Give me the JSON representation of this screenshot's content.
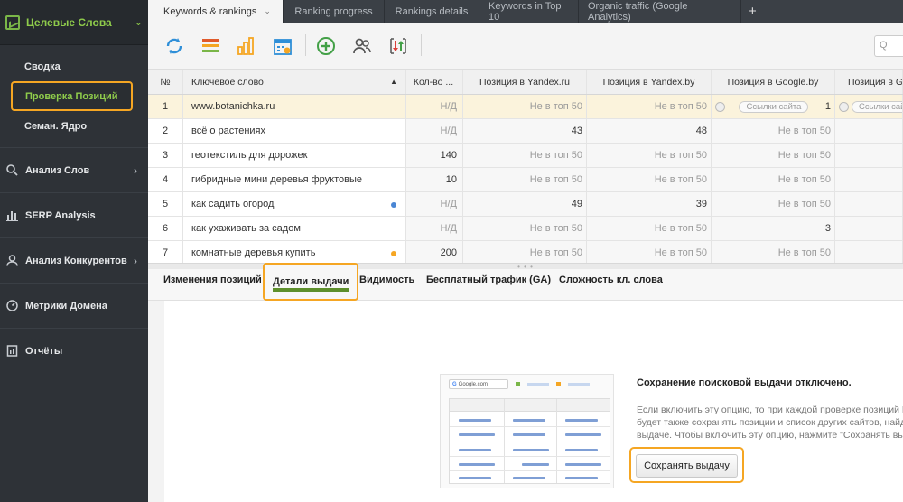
{
  "sidebar": {
    "top": {
      "label": "Целевые Слова"
    },
    "subitems": [
      {
        "label": "Сводка"
      },
      {
        "label": "Проверка Позиций"
      },
      {
        "label": "Семан. Ядро"
      }
    ],
    "items": [
      {
        "label": "Анализ Слов",
        "icon": "search-icon"
      },
      {
        "label": "SERP Analysis",
        "icon": "bar-chart-icon"
      },
      {
        "label": "Анализ Конкурентов",
        "icon": "user-icon"
      },
      {
        "label": "Метрики Домена",
        "icon": "gauge-icon"
      },
      {
        "label": "Отчёты",
        "icon": "report-icon"
      }
    ]
  },
  "tabs": [
    {
      "label": "Keywords & rankings"
    },
    {
      "label": "Ranking progress"
    },
    {
      "label": "Rankings details"
    },
    {
      "label": "Keywords in Top 10"
    },
    {
      "label": "Organic traffic (Google Analytics)"
    }
  ],
  "add_tab": "+",
  "toolbar": {
    "icons": [
      "refresh-icon",
      "list-icon",
      "bars-chart-icon",
      "calendar-icon",
      "add-icon",
      "users-icon",
      "sort-updown-icon"
    ],
    "search_placeholder": "Q"
  },
  "table": {
    "headers": {
      "num": "№",
      "keyword": "Ключевое слово",
      "volume": "Кол-во ...",
      "yandex_ru": "Позиция в Yandex.ru",
      "yandex_by": "Позиция в Yandex.by",
      "google_by": "Позиция в Google.by",
      "google_2": "Позиция в G"
    },
    "rows": [
      {
        "n": "1",
        "kw": "www.botanichka.ru",
        "vol": "Н/Д",
        "yr": "Не в топ 50",
        "yb": "Не в топ 50",
        "gb_pill": "Ссылки сайта",
        "gb": "1",
        "g2_pill": "Ссылки сайта",
        "dot": ""
      },
      {
        "n": "2",
        "kw": "всё о растениях",
        "vol": "Н/Д",
        "yr": "43",
        "yb": "48",
        "gb": "Не в топ 50",
        "g2": "",
        "dot": ""
      },
      {
        "n": "3",
        "kw": "геотекстиль для дорожек",
        "vol": "140",
        "yr": "Не в топ 50",
        "yb": "Не в топ 50",
        "gb": "Не в топ 50",
        "g2": "",
        "dot": ""
      },
      {
        "n": "4",
        "kw": "гибридные мини деревья фруктовые",
        "vol": "10",
        "yr": "Не в топ 50",
        "yb": "Не в топ 50",
        "gb": "Не в топ 50",
        "g2": "",
        "dot": ""
      },
      {
        "n": "5",
        "kw": "как садить огород",
        "vol": "Н/Д",
        "yr": "49",
        "yb": "39",
        "gb": "Не в топ 50",
        "g2": "",
        "dot": "#4a86d4"
      },
      {
        "n": "6",
        "kw": "как ухаживать за садом",
        "vol": "Н/Д",
        "yr": "Не в топ 50",
        "yb": "Не в топ 50",
        "gb": "3",
        "g2": "",
        "dot": ""
      },
      {
        "n": "7",
        "kw": "комнатные деревья купить",
        "vol": "200",
        "yr": "Не в топ 50",
        "yb": "Не в топ 50",
        "gb": "Не в топ 50",
        "g2": "",
        "dot": "#f5a623"
      }
    ]
  },
  "subtabs": [
    {
      "label": "Изменения позиций"
    },
    {
      "label": "Детали выдачи"
    },
    {
      "label": "Видимость"
    },
    {
      "label": "Бесплатный трафик (GA)"
    },
    {
      "label": "Сложность кл. слова"
    }
  ],
  "serp_panel": {
    "preview_select": "Google.com",
    "title": "Сохранение поисковой выдачи отключено.",
    "text_lines": [
      "Если включить эту опцию, то при каждой проверке позиций Ran",
      "будет также сохранять позиции и список других сайтов, найден",
      "выдаче. Чтобы включить эту опцию, нажмите \"Сохранять выда"
    ],
    "button": "Сохранять выдачу"
  },
  "colors": {
    "accent_green": "#8fcc4b",
    "highlight_orange": "#f5a623",
    "sidebar_bg": "#2e3237"
  }
}
